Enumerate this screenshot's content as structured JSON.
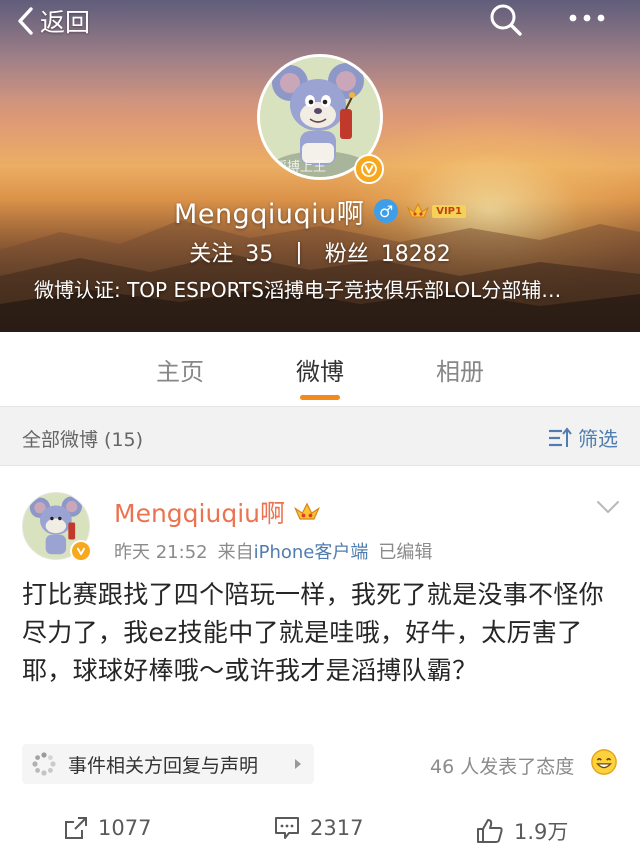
{
  "nav": {
    "back_label": "返回"
  },
  "profile": {
    "name": "Mengqiuqiu啊",
    "gender_symbol": "♂",
    "vip_label": "VIP1",
    "following_label": "关注",
    "following_count": "35",
    "divider": "|",
    "followers_label": "粉丝",
    "followers_count": "18282",
    "verification": "微博认证: TOP ESPORTS滔搏电子竞技俱乐部LOL分部辅…"
  },
  "tabs": [
    {
      "label": "主页",
      "active": false
    },
    {
      "label": "微博",
      "active": true
    },
    {
      "label": "相册",
      "active": false
    }
  ],
  "filter": {
    "count_label": "全部微博 (15)",
    "filter_label": "筛选"
  },
  "post": {
    "author": "Mengqiuqiu啊",
    "time": "昨天 21:52",
    "from_prefix": "来自",
    "client": "iPhone客户端",
    "edited": "已编辑",
    "text": "打比赛跟找了四个陪玩一样，我死了就是没事不怪你尽力了，我ez技能中了就是哇哦，好牛，太厉害了耶，球球好棒哦～或许我才是滔搏队霸？",
    "event_label": "事件相关方回复与声明",
    "attitude_text": "46 人发表了态度",
    "reposts": "1077",
    "comments": "2317",
    "likes": "1.9万"
  },
  "colors": {
    "accent_orange": "#f28a1c",
    "author_name": "#eb7350",
    "link_blue": "#507daf",
    "verified_gold": "#f7a81c"
  },
  "icons": [
    "chevron-left-icon",
    "search-icon",
    "more-icon",
    "verified-icon",
    "male-icon",
    "vip-crown-icon",
    "filter-icon",
    "chevron-down-icon",
    "topic-icon",
    "caret-right-icon",
    "smiley-icon",
    "repost-icon",
    "comment-icon",
    "like-icon"
  ]
}
